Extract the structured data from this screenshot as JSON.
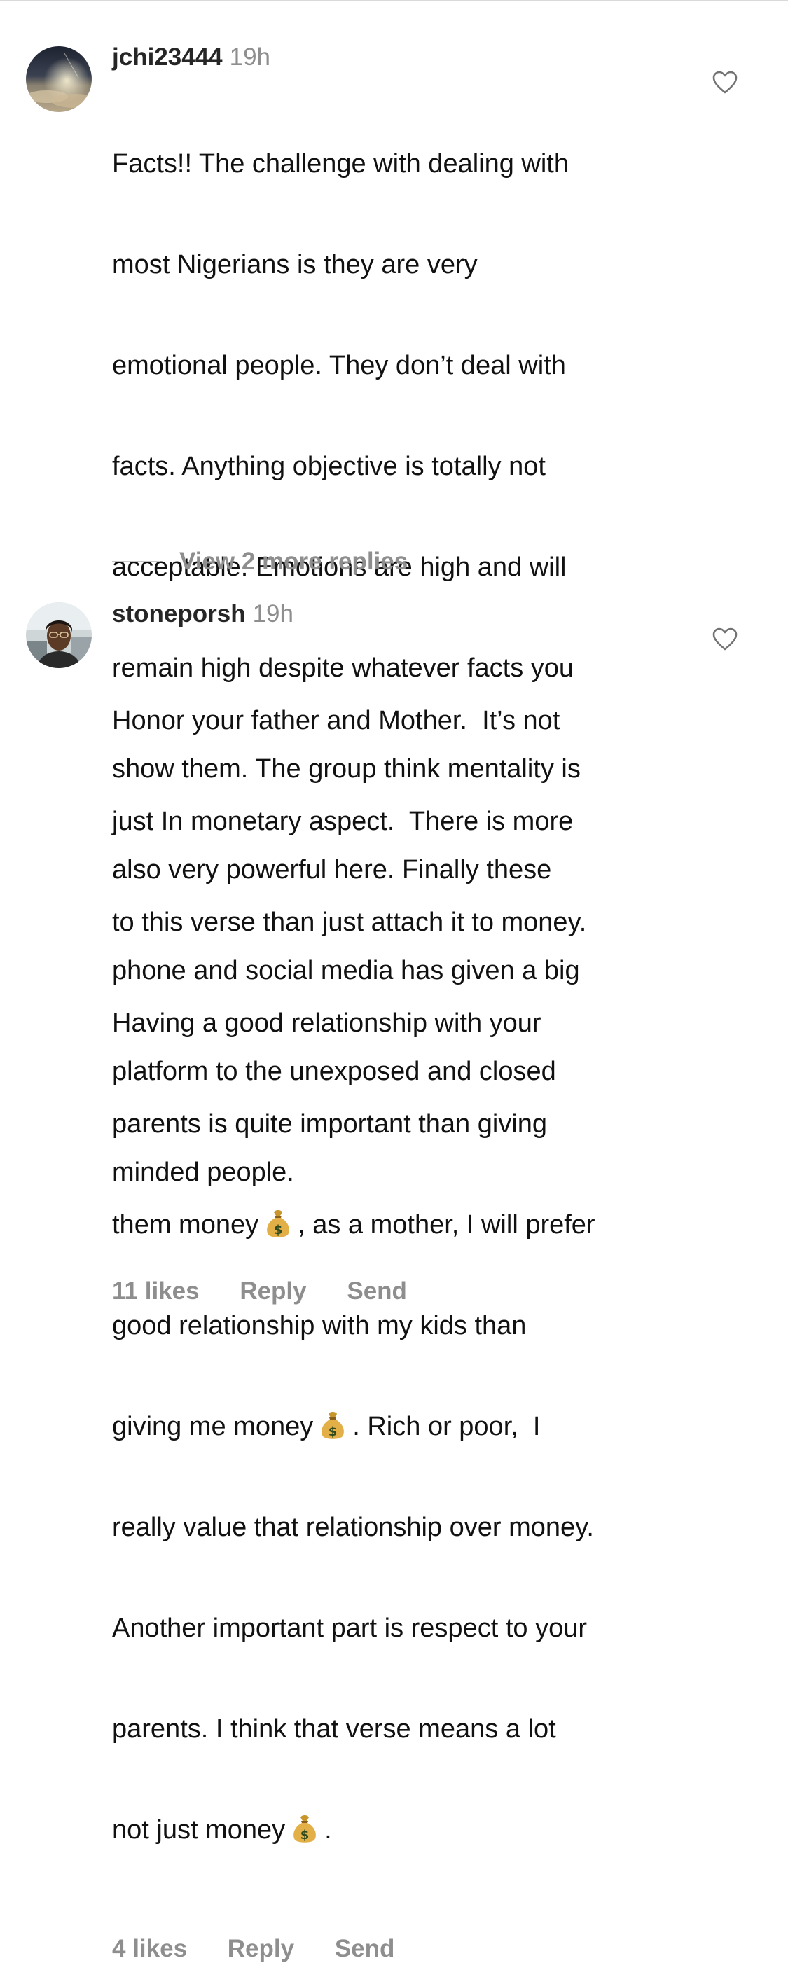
{
  "comments": [
    {
      "username": "jchi23444",
      "time": "19h",
      "lines": [
        "Facts!! The challenge with dealing with",
        "most Nigerians is they are very",
        "emotional people. They don’t deal with",
        "facts. Anything objective is totally not",
        "acceptable. Emotions are high and will",
        "remain high despite whatever facts you",
        "show them. The group think mentality is",
        "also very powerful here. Finally these",
        "phone and social media has given a big",
        "platform to the unexposed and closed",
        "minded people."
      ],
      "likes": "11 likes",
      "reply": "Reply",
      "send": "Send",
      "like_icon": "heart-outline-icon"
    },
    {
      "username": "stoneporsh",
      "time": "19h",
      "lines": [
        "Honor your father and Mother.  It’s not",
        "just In monetary aspect.  There is more",
        "to this verse than just attach it to money.",
        "Having a good relationship with your",
        "parents is quite important than giving"
      ],
      "line6_pre": "them money",
      "line6_post": ", as a mother, I will prefer",
      "line7": "good relationship with my kids than",
      "line8_pre": "giving me money",
      "line8_post": ". Rich or poor,  I",
      "lines_after": [
        "really value that relationship over money.",
        "Another important part is respect to your",
        "parents. I think that verse means a lot"
      ],
      "last_pre": "not just money",
      "last_post": ".",
      "emoji": "money-bag-emoji",
      "likes": "4 likes",
      "reply": "Reply",
      "send": "Send",
      "like_icon": "heart-outline-icon"
    }
  ],
  "view_replies": "View 2 more replies",
  "colors": {
    "text": "#111111",
    "username": "#262626",
    "muted": "#8e8e8e",
    "divider": "#c7c7c7"
  }
}
